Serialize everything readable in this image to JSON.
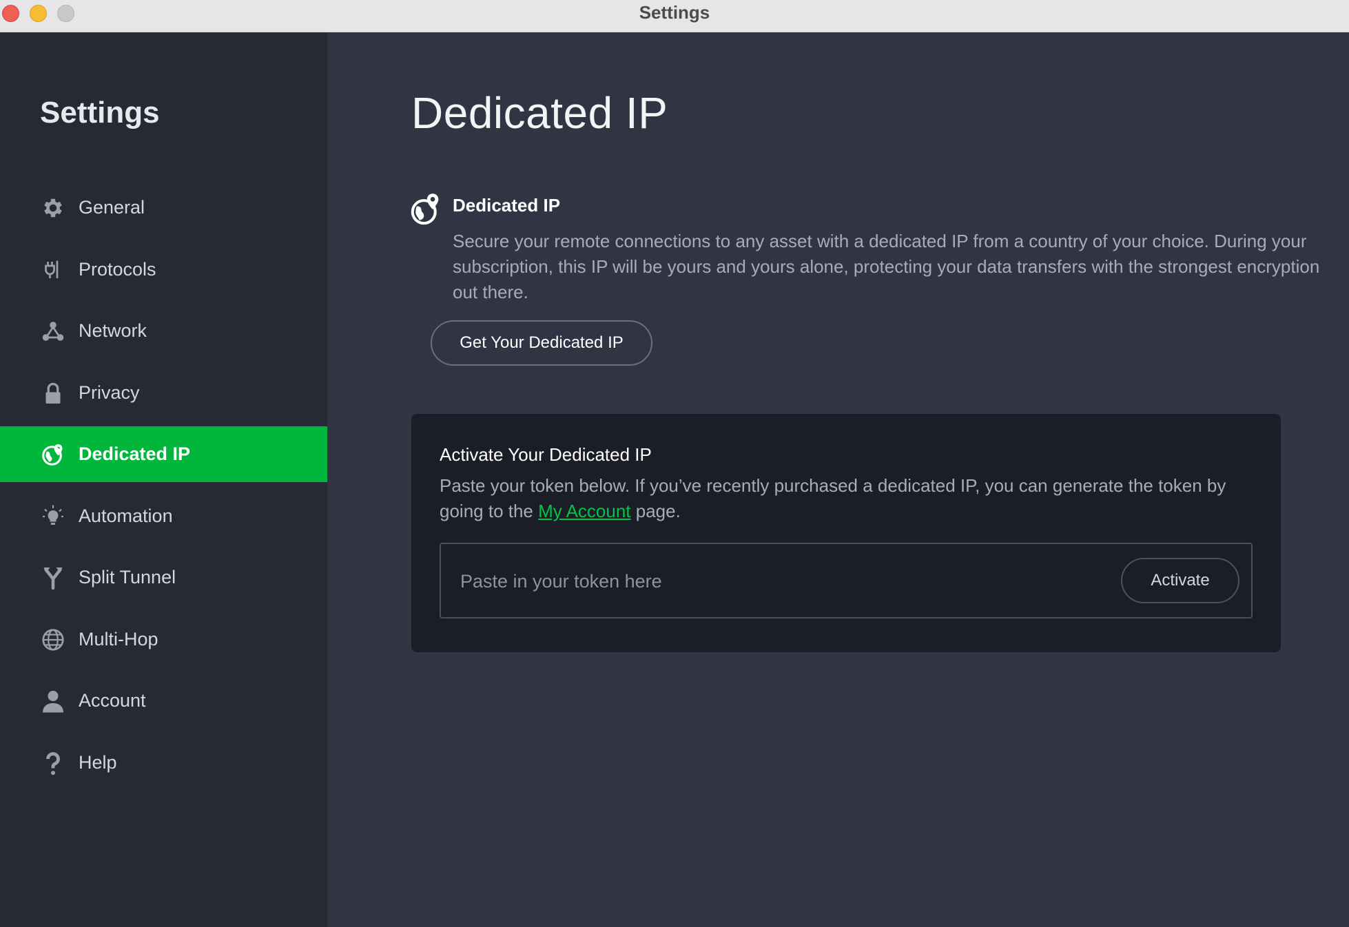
{
  "window": {
    "title": "Settings"
  },
  "sidebar": {
    "title": "Settings",
    "items": [
      {
        "label": "General",
        "icon": "gear-icon"
      },
      {
        "label": "Protocols",
        "icon": "plug-icon"
      },
      {
        "label": "Network",
        "icon": "network-icon"
      },
      {
        "label": "Privacy",
        "icon": "lock-icon"
      },
      {
        "label": "Dedicated IP",
        "icon": "dedicated-ip-icon",
        "active": true
      },
      {
        "label": "Automation",
        "icon": "lightbulb-icon"
      },
      {
        "label": "Split Tunnel",
        "icon": "split-tunnel-icon"
      },
      {
        "label": "Multi-Hop",
        "icon": "globe-icon"
      },
      {
        "label": "Account",
        "icon": "user-icon"
      },
      {
        "label": "Help",
        "icon": "question-icon"
      }
    ]
  },
  "main": {
    "page_title": "Dedicated IP",
    "feature": {
      "title": "Dedicated IP",
      "description": "Secure your remote connections to any asset with a dedicated IP from a country of your choice. During your subscription, this IP will be yours and yours alone, protecting your data transfers with the strongest encryption out there.",
      "button_label": "Get Your Dedicated IP"
    },
    "activate": {
      "title": "Activate Your Dedicated IP",
      "desc_before": "Paste your token below. If you’ve recently purchased a dedicated IP, you can generate the token by going to the ",
      "link_text": "My Account",
      "desc_after": " page.",
      "token_placeholder": "Paste in your token here",
      "token_value": "",
      "button_label": "Activate"
    }
  },
  "colors": {
    "accent": "#00b73c",
    "link": "#00c447",
    "sidebar_bg": "#262a35",
    "main_bg": "#313543",
    "card_bg": "#1b1e27"
  }
}
